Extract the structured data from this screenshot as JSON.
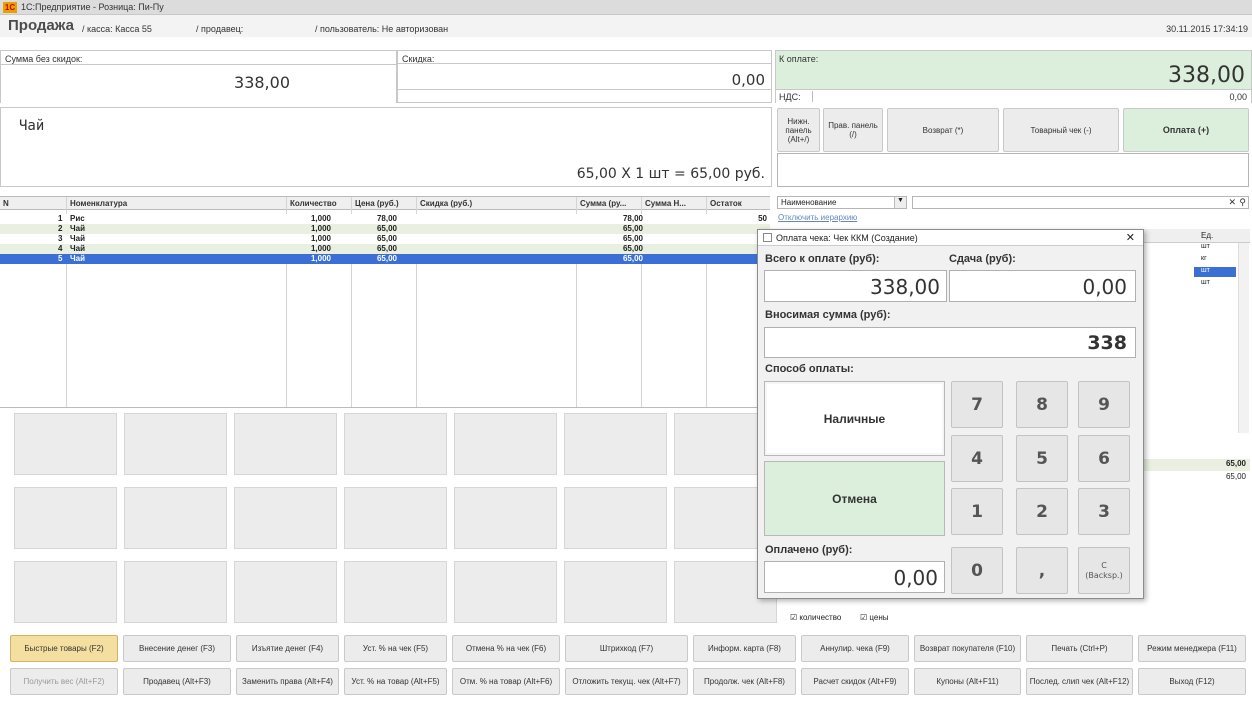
{
  "window": {
    "title": "1С:Предприятие - Розница: Пи-Пу"
  },
  "header": {
    "title": "Продажа",
    "kassa": "/ касса: Касса 55",
    "seller": "/ продавец:",
    "user": "/ пользователь: Не авторизован",
    "datetime": "30.11.2015 17:34:19"
  },
  "sums": {
    "no_discount_label": "Сумма без скидок:",
    "no_discount": "338,00",
    "discount_label": "Скидка:",
    "discount": "0,00",
    "to_pay_label": "К оплате:",
    "to_pay": "338,00",
    "vat_label": "НДС:",
    "vat": "0,00"
  },
  "item": {
    "name": "Чай",
    "calc": "65,00  X 1 шт = 65,00  руб."
  },
  "right_buttons": {
    "lower_panel": "Нижн. панель (Alt+/)",
    "right_panel": "Прав. панель (/)",
    "return": "Возврат (*)",
    "goods_receipt": "Товарный чек (-)",
    "payment": "Оплата (+)"
  },
  "table": {
    "headers": [
      "N",
      "Номенклатура",
      "Количество",
      "Цена (руб.)",
      "Скидка (руб.)",
      "Сумма (ру...",
      "Сумма Н...",
      "Остаток"
    ],
    "rows": [
      {
        "n": "1",
        "name": "Рис",
        "qty": "1,000",
        "price": "78,00",
        "sum": "78,00",
        "rest": "50"
      },
      {
        "n": "2",
        "name": "Чай",
        "qty": "1,000",
        "price": "65,00",
        "sum": "65,00",
        "rest": ""
      },
      {
        "n": "3",
        "name": "Чай",
        "qty": "1,000",
        "price": "65,00",
        "sum": "65,00",
        "rest": ""
      },
      {
        "n": "4",
        "name": "Чай",
        "qty": "1,000",
        "price": "65,00",
        "sum": "65,00",
        "rest": ""
      },
      {
        "n": "5",
        "name": "Чай",
        "qty": "1,000",
        "price": "65,00",
        "sum": "65,00",
        "rest": ""
      }
    ]
  },
  "search": {
    "field": "Наименование",
    "hierarchy": "Отключить иерархию",
    "unit_col": "Ед.",
    "units": [
      "шт",
      "кг",
      "шт",
      "шт"
    ]
  },
  "right_totals": {
    "total": "65,00",
    "sub": "65,00"
  },
  "checks": {
    "qty": "количество",
    "price": "цены"
  },
  "dialog": {
    "title": "Оплата чека: Чек ККМ (Создание)",
    "total_label": "Всего к оплате (руб):",
    "total": "338,00",
    "change_label": "Сдача (руб):",
    "change": "0,00",
    "deposit_label": "Вносимая сумма (руб):",
    "deposit": "338",
    "method_label": "Способ оплаты:",
    "cash": "Наличные",
    "cancel": "Отмена",
    "paid_label": "Оплачено (руб):",
    "paid": "0,00",
    "keys": [
      "7",
      "8",
      "9",
      "4",
      "5",
      "6",
      "1",
      "2",
      "3",
      "0",
      ",",
      "C\n(Backsp.)"
    ]
  },
  "bottom_row1": [
    "Быстрые товары (F2)",
    "Внесение денег (F3)",
    "Изъятие денег (F4)",
    "Уст. % на чек (F5)",
    "Отмена % на чек (F6)",
    "Штрихкод (F7)",
    "Информ. карта (F8)",
    "Аннулир. чека (F9)",
    "Возврат покупателя (F10)",
    "Печать (Ctrl+P)",
    "Режим менеджера (F11)"
  ],
  "bottom_row2": [
    "Получить вес (Alt+F2)",
    "Продавец (Alt+F3)",
    "Заменить права (Alt+F4)",
    "Уст. % на товар (Alt+F5)",
    "Отм. % на товар (Alt+F6)",
    "Отложить текущ. чек (Alt+F7)",
    "Продолж. чек (Alt+F8)",
    "Расчет скидок (Alt+F9)",
    "Купоны (Alt+F11)",
    "Послед. слип чек (Alt+F12)",
    "Выход (F12)"
  ],
  "colors": {
    "selected_row": "#3c6fd6",
    "payment_bg": "#dcefdc",
    "active_btn": "#f4dfa0"
  }
}
